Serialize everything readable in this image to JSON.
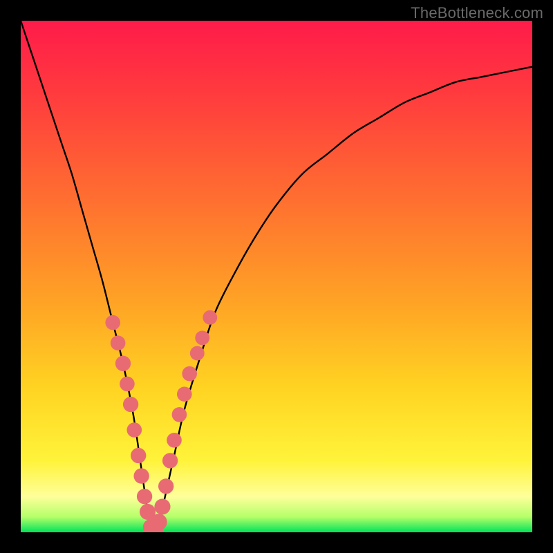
{
  "watermark": "TheBottleneck.com",
  "gradient": {
    "c0": "#ff1b4a",
    "c1": "#ff3a3e",
    "c2": "#ff6f30",
    "c3": "#ffa325",
    "c4": "#ffd422",
    "c5": "#fff33a",
    "c6": "#ffff9a",
    "c7": "#b4ff6a",
    "c8": "#00e35a"
  },
  "chart_data": {
    "type": "line",
    "title": "",
    "xlabel": "",
    "ylabel": "",
    "xlim": [
      0,
      100
    ],
    "ylim": [
      0,
      100
    ],
    "series": [
      {
        "name": "bottleneck-curve",
        "x": [
          0,
          2,
          4,
          6,
          8,
          10,
          12,
          14,
          16,
          18,
          20,
          22,
          23.5,
          25,
          26,
          27,
          28,
          30,
          32,
          35,
          38,
          42,
          46,
          50,
          55,
          60,
          65,
          70,
          75,
          80,
          85,
          90,
          95,
          100
        ],
        "y": [
          100,
          94,
          88,
          82,
          76,
          70,
          63,
          56,
          49,
          41,
          33,
          23,
          13,
          3,
          0,
          1,
          6,
          15,
          24,
          34,
          43,
          51,
          58,
          64,
          70,
          74,
          78,
          81,
          84,
          86,
          88,
          89,
          90,
          91
        ]
      }
    ],
    "markers": {
      "name": "highlight-dots",
      "points": [
        {
          "x": 18.0,
          "y": 41,
          "r": 1.3
        },
        {
          "x": 19.0,
          "y": 37,
          "r": 1.3
        },
        {
          "x": 20.0,
          "y": 33,
          "r": 1.4
        },
        {
          "x": 20.8,
          "y": 29,
          "r": 1.3
        },
        {
          "x": 21.5,
          "y": 25,
          "r": 1.4
        },
        {
          "x": 22.2,
          "y": 20,
          "r": 1.3
        },
        {
          "x": 23.0,
          "y": 15,
          "r": 1.4
        },
        {
          "x": 23.6,
          "y": 11,
          "r": 1.4
        },
        {
          "x": 24.2,
          "y": 7,
          "r": 1.4
        },
        {
          "x": 24.8,
          "y": 4,
          "r": 1.5
        },
        {
          "x": 25.5,
          "y": 1,
          "r": 1.6
        },
        {
          "x": 26.2,
          "y": 0,
          "r": 1.7
        },
        {
          "x": 27.0,
          "y": 2,
          "r": 1.6
        },
        {
          "x": 27.7,
          "y": 5,
          "r": 1.5
        },
        {
          "x": 28.4,
          "y": 9,
          "r": 1.4
        },
        {
          "x": 29.2,
          "y": 14,
          "r": 1.4
        },
        {
          "x": 30.0,
          "y": 18,
          "r": 1.3
        },
        {
          "x": 31.0,
          "y": 23,
          "r": 1.3
        },
        {
          "x": 32.0,
          "y": 27,
          "r": 1.3
        },
        {
          "x": 33.0,
          "y": 31,
          "r": 1.3
        },
        {
          "x": 34.5,
          "y": 35,
          "r": 1.2
        },
        {
          "x": 35.5,
          "y": 38,
          "r": 1.2
        },
        {
          "x": 37.0,
          "y": 42,
          "r": 1.2
        }
      ]
    }
  }
}
